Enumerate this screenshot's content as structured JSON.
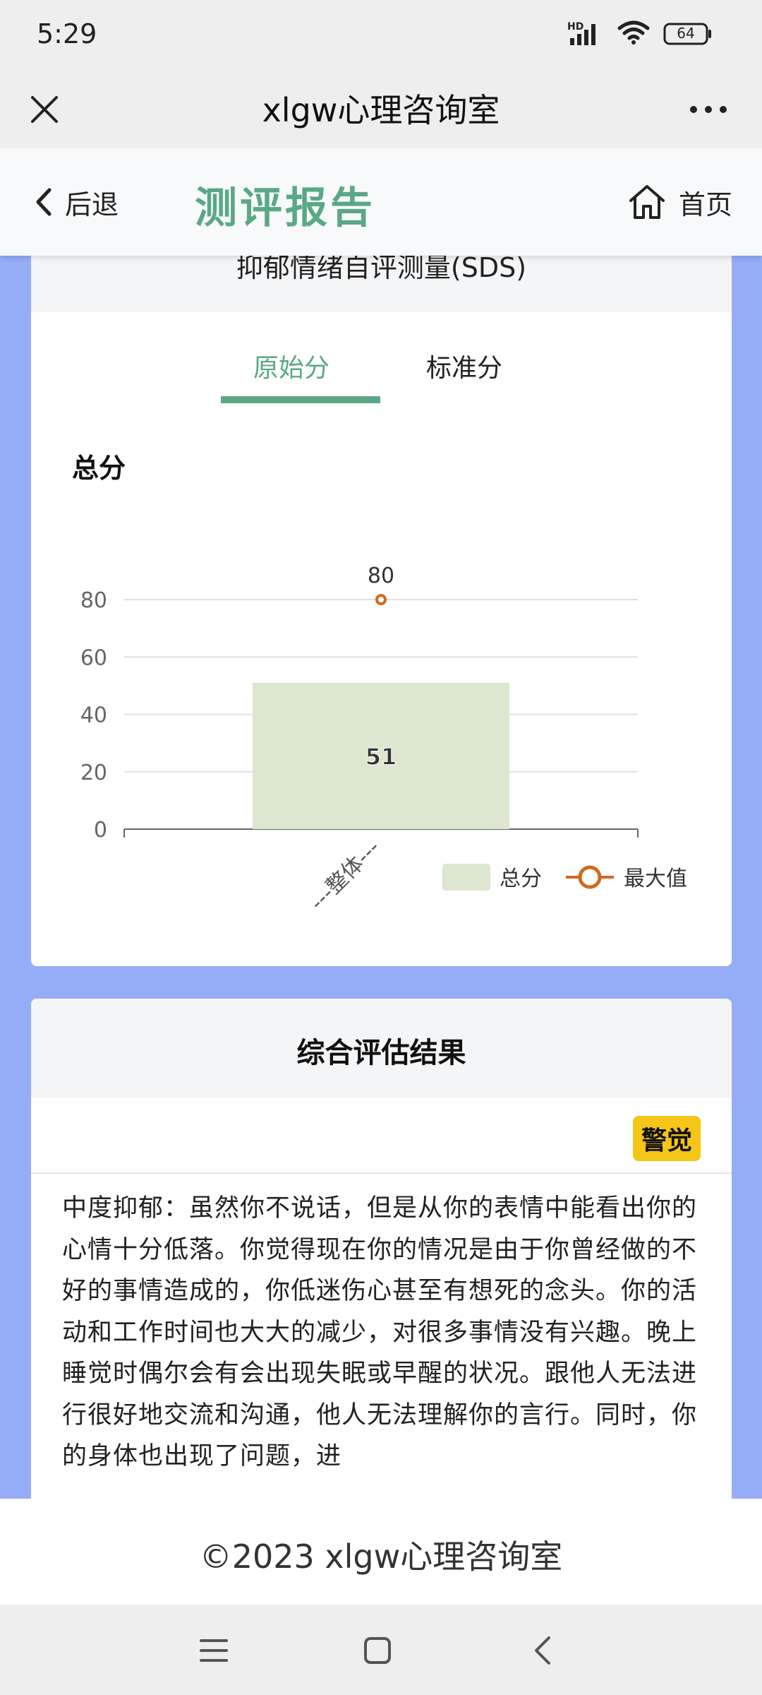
{
  "status": {
    "time": "5:29",
    "battery": "64",
    "hd": "HD"
  },
  "titlebar": {
    "title": "xlgw心理咨询室"
  },
  "header": {
    "back_label": "后退",
    "title": "测评报告",
    "home_label": "首页"
  },
  "report": {
    "scale_title": "抑郁情绪自评测量(SDS)",
    "tabs": [
      {
        "label": "原始分",
        "active": true
      },
      {
        "label": "标准分",
        "active": false
      }
    ],
    "chart_heading": "总分"
  },
  "chart_data": {
    "type": "bar",
    "title": "总分",
    "categories": [
      "---整体---"
    ],
    "series": [
      {
        "name": "总分",
        "kind": "bar",
        "values": [
          51
        ],
        "color": "#dde6cf"
      },
      {
        "name": "最大值",
        "kind": "point",
        "values": [
          80
        ],
        "color": "#d2691e"
      }
    ],
    "yticks": [
      "0",
      "20",
      "40",
      "60",
      "80"
    ],
    "ylim": [
      0,
      80
    ],
    "bar_label": "51",
    "point_label": "80",
    "legend_position": "bottom-right"
  },
  "result": {
    "title": "综合评估结果",
    "badge": "警觉",
    "badge_color": "#f5c518",
    "description": "中度抑郁：虽然你不说话，但是从你的表情中能看出你的心情十分低落。你觉得现在你的情况是由于你曾经做的不好的事情造成的，你低迷伤心甚至有想死的念头。你的活动和工作时间也大大的减少，对很多事情没有兴趣。晚上睡觉时偶尔会有会出现失眠或早醒的状况。跟他人无法进行很好地交流和沟通，他人无法理解你的言行。同时，你的身体也出现了问题，进"
  },
  "footer": {
    "text": "©2023 xlgw心理咨询室"
  },
  "theme": {
    "accent": "#5aa886",
    "page_bg": "#95adf6"
  }
}
